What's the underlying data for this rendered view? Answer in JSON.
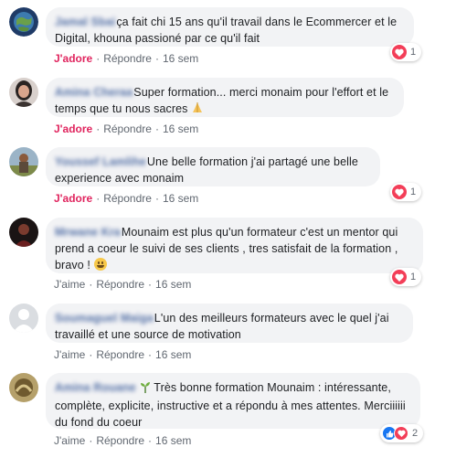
{
  "comments": [
    {
      "author": "Jamal Sbai",
      "text": "ça fait chi 15 ans qu'il travail dans le Ecommercer et le Digital, khouna passioné par ce qu'il fait",
      "like_label": "J'adore",
      "reply_label": "Répondre",
      "time": "16 sem",
      "reaction_count": "1",
      "reaction": "heart"
    },
    {
      "author": "Amina Cheraa",
      "text": "Super formation... merci monaim pour l'effort et le temps que tu nous sacres",
      "like_label": "J'adore",
      "reply_label": "Répondre",
      "time": "16 sem",
      "reaction_count": "",
      "reaction": ""
    },
    {
      "author": "Youssef Lamlihe",
      "text": "Une belle formation j'ai partagé une belle experience avec monaim",
      "like_label": "J'adore",
      "reply_label": "Répondre",
      "time": "16 sem",
      "reaction_count": "1",
      "reaction": "heart"
    },
    {
      "author": "Mrwane Kra",
      "text": "Mounaim est plus qu'un formateur c'est un mentor qui prend a coeur le suivi de ses clients , tres satisfait de la formation , bravo !",
      "like_label": "J'aime",
      "reply_label": "Répondre",
      "time": "16 sem",
      "reaction_count": "1",
      "reaction": "heart"
    },
    {
      "author": "Soumaguel Maiga",
      "text": "L'un des meilleurs formateurs avec le quel j'ai travaillé et une source de motivation",
      "like_label": "J'aime",
      "reply_label": "Répondre",
      "time": "16 sem",
      "reaction_count": "",
      "reaction": ""
    },
    {
      "author": "Amina Rouane",
      "text": "Très bonne formation Mounaim : intéressante, complète, explicite, instructive et a répondu à mes attentes. Merciiiiii du fond du coeur",
      "like_label": "J'aime",
      "reply_label": "Répondre",
      "time": "16 sem",
      "reaction_count": "2",
      "reaction": "like-heart"
    }
  ],
  "colors": {
    "bubble_bg": "#f2f3f5",
    "author_link": "#385898",
    "adore_active": "#e0245e",
    "meta_text": "#606770",
    "heart": "#f33e58",
    "like_blue": "#1877f2"
  }
}
